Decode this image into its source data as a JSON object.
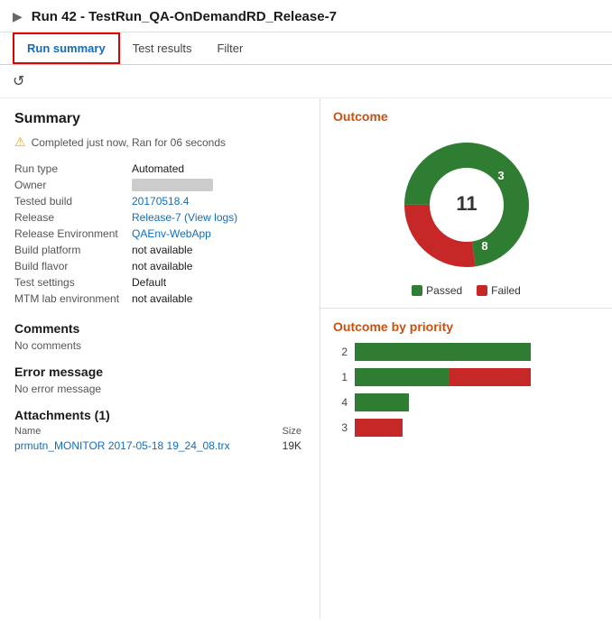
{
  "title": "Run 42 - TestRun_QA-OnDemandRD_Release-7",
  "tabs": [
    {
      "label": "Run summary",
      "active": true
    },
    {
      "label": "Test results",
      "active": false
    },
    {
      "label": "Filter",
      "active": false
    }
  ],
  "toolbar": {
    "refresh_icon": "↺"
  },
  "summary": {
    "section_title": "Summary",
    "warning_text": "Completed just now, Ran for 06 seconds",
    "fields": [
      {
        "label": "Run type",
        "value": "Automated",
        "type": "text"
      },
      {
        "label": "Owner",
        "value": "",
        "type": "blur"
      },
      {
        "label": "Tested build",
        "value": "20170518.4",
        "type": "link"
      },
      {
        "label": "Release",
        "value": "Release-7 (View logs)",
        "type": "link"
      },
      {
        "label": "Release Environment",
        "value": "QAEnv-WebApp",
        "type": "link"
      },
      {
        "label": "Build platform",
        "value": "not available",
        "type": "text"
      },
      {
        "label": "Build flavor",
        "value": "not available",
        "type": "text"
      },
      {
        "label": "Test settings",
        "value": "Default",
        "type": "text"
      },
      {
        "label": "MTM lab environment",
        "value": "not available",
        "type": "text"
      }
    ]
  },
  "comments": {
    "title": "Comments",
    "value": "No comments"
  },
  "error_message": {
    "title": "Error message",
    "value": "No error message"
  },
  "attachments": {
    "title": "Attachments (1)",
    "name_header": "Name",
    "size_header": "Size",
    "items": [
      {
        "name": "prmutn_MONITOR 2017-05-18 19_24_08.trx",
        "size": "19K"
      }
    ]
  },
  "outcome": {
    "title": "Outcome",
    "total": "11",
    "passed": 8,
    "failed": 3,
    "legend": [
      {
        "label": "Passed",
        "color": "#2e7d32"
      },
      {
        "label": "Failed",
        "color": "#c62828"
      }
    ]
  },
  "outcome_by_priority": {
    "title": "Outcome by priority",
    "bars": [
      {
        "priority": "2",
        "passed": 130,
        "failed": 0
      },
      {
        "priority": "1",
        "passed": 70,
        "failed": 60
      },
      {
        "priority": "4",
        "passed": 40,
        "failed": 0
      },
      {
        "priority": "3",
        "passed": 0,
        "failed": 35
      }
    ]
  }
}
